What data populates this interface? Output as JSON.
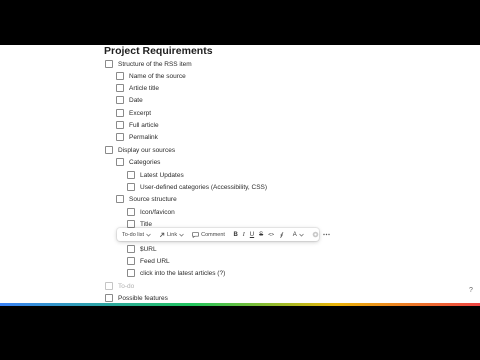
{
  "document": {
    "title": "Project Requirements",
    "items": [
      {
        "label": "Structure of the RSS item"
      },
      {
        "label": "Name of the source"
      },
      {
        "label": "Article title"
      },
      {
        "label": "Date"
      },
      {
        "label": "Excerpt"
      },
      {
        "label": "Full article"
      },
      {
        "label": "Permalink"
      },
      {
        "label": "Display our sources"
      },
      {
        "label": "Categories"
      },
      {
        "label": "Latest Updates"
      },
      {
        "label": "User-defined categories (Accessibility, CSS)"
      },
      {
        "label": "Source structure"
      },
      {
        "label": "Icon/favicon"
      },
      {
        "label": "Title"
      },
      {
        "label": "$URL"
      },
      {
        "label": "Feed URL"
      },
      {
        "label": "click into the latest articles (?)"
      },
      {
        "label": "To-do"
      },
      {
        "label": "Possible features"
      }
    ]
  },
  "toolbar": {
    "block_type": "To-do list",
    "link": "Link",
    "comment": "Comment",
    "bold": "B",
    "italic": "I",
    "underline": "U",
    "strike": "S",
    "code": "<>",
    "color": "A"
  },
  "help": {
    "label": "?"
  }
}
